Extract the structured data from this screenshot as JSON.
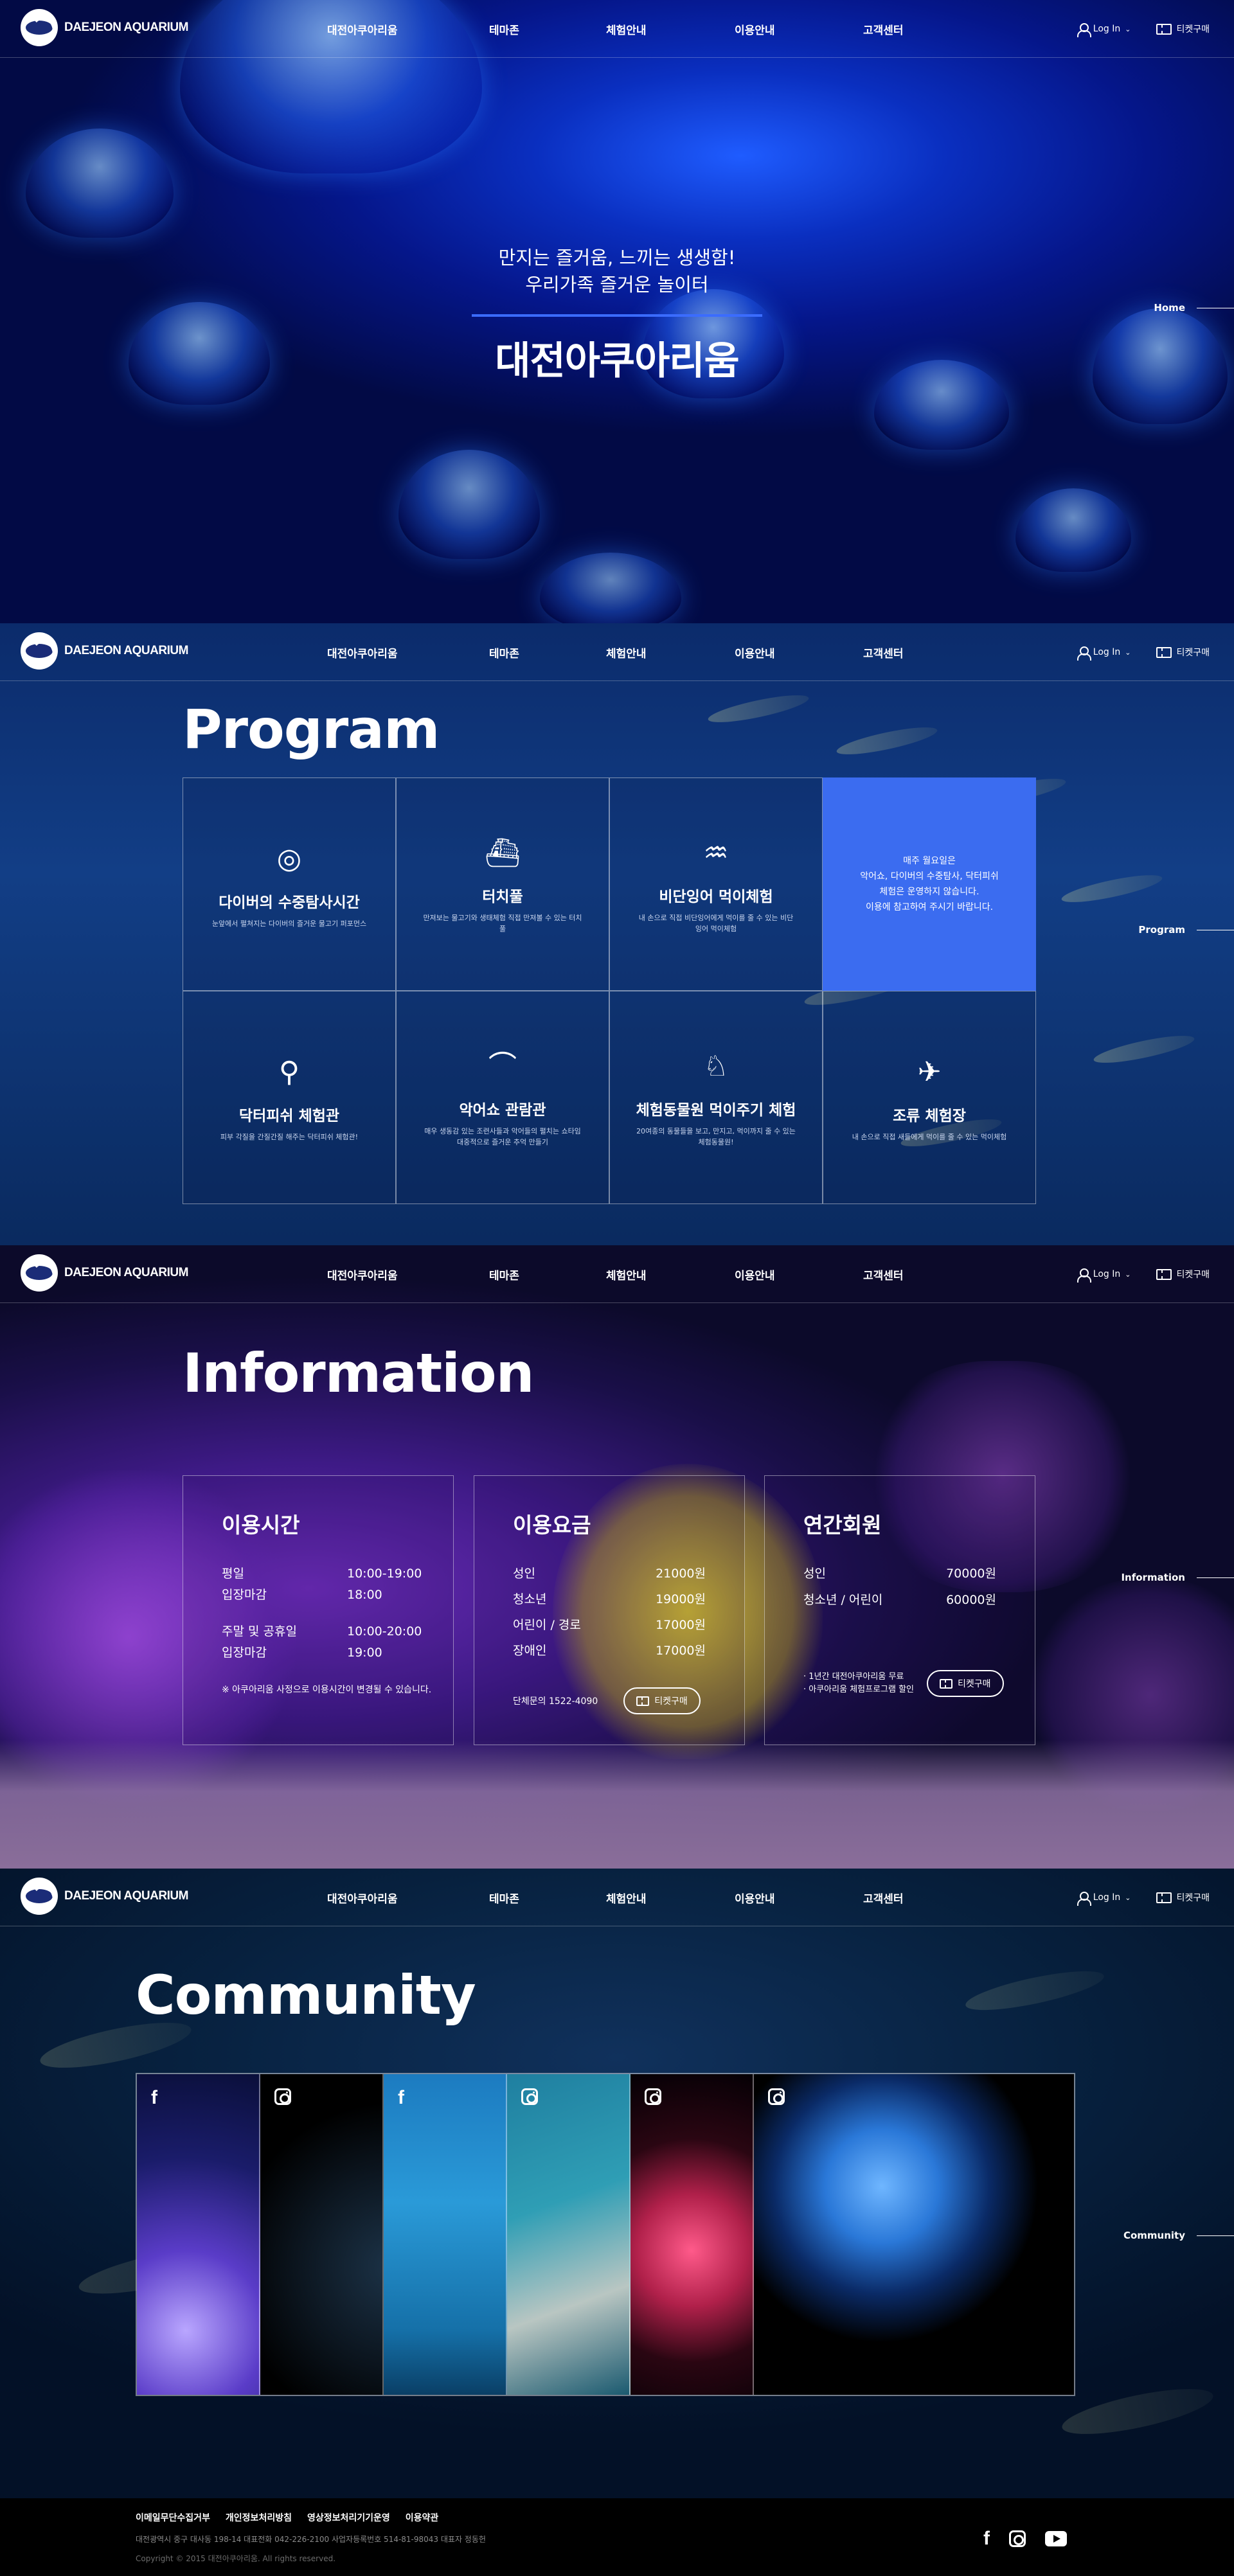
{
  "header": {
    "logo_text": "DAEJEON AQUARIUM",
    "nav": [
      "대전아쿠아리움",
      "테마존",
      "체험안내",
      "이용안내",
      "고객센터"
    ],
    "login_label": "Log In",
    "ticket_label": "티켓구매"
  },
  "hero": {
    "line1": "만지는 즐거움, 느끼는 생생함!",
    "line2": "우리가족 즐거운 놀이터",
    "title": "대전아쿠아리움",
    "side_label": "Home"
  },
  "program": {
    "title": "Program",
    "side_label": "Program",
    "items": [
      {
        "icon": "diver-mask-icon",
        "title": "다이버의 수중탐사시간",
        "desc": "눈앞에서 펼쳐지는 다이버의 즐거운 물고기 퍼포먼스"
      },
      {
        "icon": "submarine-icon",
        "title": "터치풀",
        "desc": "만져보는 물고기와 생태체험 직접 만져볼 수 있는 터치풀"
      },
      {
        "icon": "fish-feeding-icon",
        "title": "비단잉어 먹이체험",
        "desc": "내 손으로 직접 비단잉어에게 먹이를 줄 수 있는 비단잉어 먹이체험"
      },
      {
        "icon": "",
        "title": "",
        "desc": "",
        "highlight": [
          "매주 월요일은",
          "악어쇼, 다이버의 수중탐사, 닥터피쉬",
          "체험은 운영하지 않습니다.",
          "이용에 참고하여 주시기 바랍니다."
        ]
      },
      {
        "icon": "doctor-fish-icon",
        "title": "닥터피쉬 체험관",
        "desc": "피부 각질을 간질간질 해주는 닥터피쉬 체험관!"
      },
      {
        "icon": "crocodile-icon",
        "title": "악어쇼 관람관",
        "desc": "매우 생동감 있는 조련사들과 악어들의 펼치는 쇼타임 대중적으로 즐거운 추억 만들기"
      },
      {
        "icon": "rabbit-icon",
        "title": "체험동물원 먹이주기 체험",
        "desc": "20여종의 동물들을 보고, 만지고, 먹이까지 줄 수 있는 체험동물원!"
      },
      {
        "icon": "bird-icon",
        "title": "조류 체험장",
        "desc": "내 손으로 직접 새들에게 먹이를 줄 수 있는 먹이체험"
      }
    ]
  },
  "info": {
    "title": "Information",
    "side_label": "Information",
    "hours": {
      "heading": "이용시간",
      "rows": [
        {
          "k": "평일",
          "v": "10:00-19:00"
        },
        {
          "k": "입장마감",
          "v": "18:00"
        },
        {
          "k": "주말 및 공휴일",
          "v": "10:00-20:00"
        },
        {
          "k": "입장마감",
          "v": "19:00"
        }
      ],
      "note": "※ 아쿠아리움 사정으로 이용시간이 변경될 수 있습니다."
    },
    "fees": {
      "heading": "이용요금",
      "rows": [
        {
          "k": "성인",
          "v": "21000원"
        },
        {
          "k": "청소년",
          "v": "19000원"
        },
        {
          "k": "어린이 / 경로",
          "v": "17000원"
        },
        {
          "k": "장애인",
          "v": "17000원"
        }
      ],
      "group_info": "단체문의 1522-4090",
      "button": "티켓구매"
    },
    "annual": {
      "heading": "연간회원",
      "rows": [
        {
          "k": "성인",
          "v": "70000원"
        },
        {
          "k": "청소년 / 어린이",
          "v": "60000원"
        }
      ],
      "benefit1": "· 1년간 대전아쿠아리움 무료",
      "benefit2": "· 아쿠아리움 체험프로그램 할인",
      "button": "티켓구매"
    }
  },
  "community": {
    "title": "Community",
    "side_label": "Community",
    "tiles": [
      {
        "icon": "facebook-icon"
      },
      {
        "icon": "instagram-icon"
      },
      {
        "icon": "facebook-icon"
      },
      {
        "icon": "instagram-icon"
      },
      {
        "icon": "instagram-icon"
      },
      {
        "icon": "instagram-icon"
      }
    ]
  },
  "footer": {
    "links": [
      "이메일무단수집거부",
      "개인정보처리방침",
      "영상정보처리기기운영",
      "이용약관"
    ],
    "address": "대전광역시 중구 대사동 198-14   대표전화 042-226-2100   사업자등록번호 514-81-98043   대표자 정동헌",
    "copyright": "Copyright © 2015 대전아쿠아리움. All rights reserved.",
    "sns": [
      "facebook-icon",
      "instagram-icon",
      "youtube-icon"
    ]
  },
  "colors": {
    "accent": "#3b6cf0",
    "hero_bg": "#0a2fc0",
    "info_bg": "#3e1a86",
    "footer_bg": "#000000"
  }
}
